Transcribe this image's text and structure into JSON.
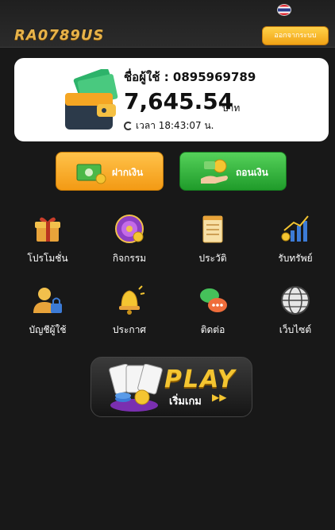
{
  "header": {
    "logo_text": "RA0789US",
    "language_flag": "thai-flag-icon",
    "logout_label": "ออกจากระบบ"
  },
  "balance_card": {
    "user_label": "ชื่อผู้ใช้ : 0895969789",
    "balance": "7,645.54",
    "currency": "บาท",
    "time_label": "เวลา 18:43:07 น.",
    "icon": "wallet-icon"
  },
  "actions": {
    "deposit_label": "ฝากเงิน",
    "withdraw_label": "ถอนเงิน",
    "deposit_color": "#f5a623",
    "withdraw_color": "#2ea836"
  },
  "menu": [
    {
      "label": "โปรโมชั่น",
      "icon": "gift-icon"
    },
    {
      "label": "กิจกรรม",
      "icon": "wheel-icon"
    },
    {
      "label": "ประวัติ",
      "icon": "notepad-icon"
    },
    {
      "label": "รับทรัพย์",
      "icon": "chart-coins-icon"
    },
    {
      "label": "บัญชีผู้ใช้",
      "icon": "user-lock-icon"
    },
    {
      "label": "ประกาศ",
      "icon": "bell-icon"
    },
    {
      "label": "ติดต่อ",
      "icon": "chat-icon"
    },
    {
      "label": "เว็บไซต์",
      "icon": "globe-icon"
    }
  ],
  "play_banner": {
    "title": "PLAY",
    "subtitle": "เริ่มเกม",
    "arrows": "▶▶",
    "icon": "cards-chips-icon"
  }
}
